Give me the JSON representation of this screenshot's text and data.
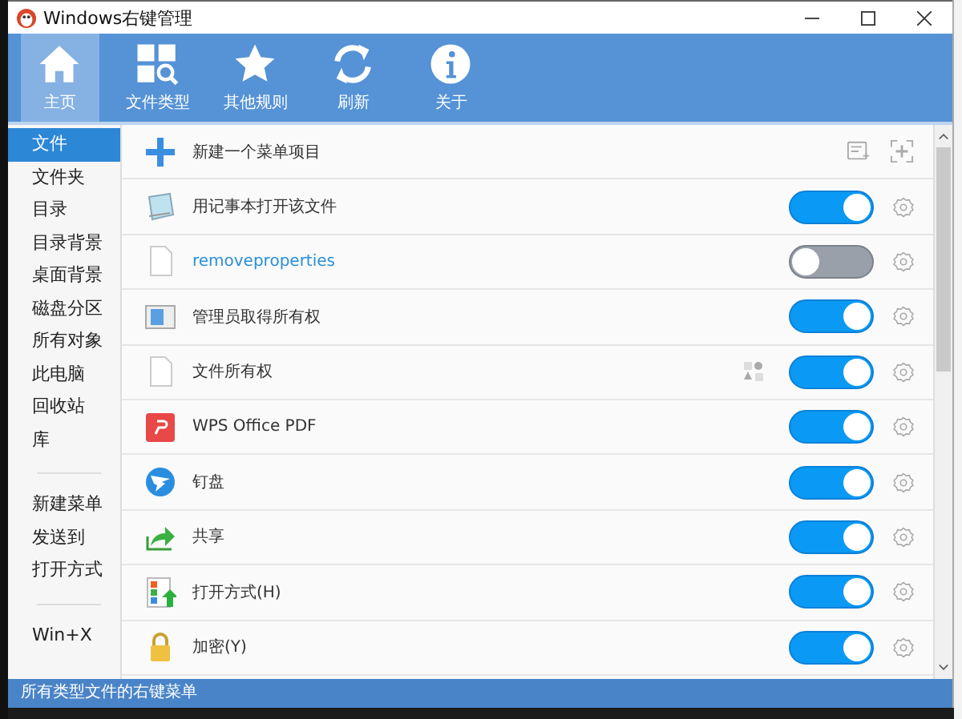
{
  "window": {
    "title": "Windows右键管理"
  },
  "toolbar": [
    {
      "label": "主页",
      "selected": true
    },
    {
      "label": "文件类型",
      "selected": false
    },
    {
      "label": "其他规则",
      "selected": false
    },
    {
      "label": "刷新",
      "selected": false
    },
    {
      "label": "关于",
      "selected": false
    }
  ],
  "sidebar": {
    "groups": [
      [
        {
          "label": "文件",
          "selected": true
        },
        {
          "label": "文件夹",
          "selected": false
        },
        {
          "label": "目录",
          "selected": false
        },
        {
          "label": "目录背景",
          "selected": false
        },
        {
          "label": "桌面背景",
          "selected": false
        },
        {
          "label": "磁盘分区",
          "selected": false
        },
        {
          "label": "所有对象",
          "selected": false
        },
        {
          "label": "此电脑",
          "selected": false
        },
        {
          "label": "回收站",
          "selected": false
        },
        {
          "label": "库",
          "selected": false
        }
      ],
      [
        {
          "label": "新建菜单",
          "selected": false
        },
        {
          "label": "发送到",
          "selected": false
        },
        {
          "label": "打开方式",
          "selected": false
        }
      ],
      [
        {
          "label": "Win+X",
          "selected": false
        }
      ]
    ]
  },
  "items": [
    {
      "kind": "new",
      "label": "新建一个菜单项目"
    },
    {
      "kind": "entry",
      "label": "用记事本打开该文件",
      "on": true,
      "highlighted": false,
      "extra": false
    },
    {
      "kind": "entry",
      "label": "removeproperties",
      "on": false,
      "highlighted": true,
      "extra": false
    },
    {
      "kind": "entry",
      "label": "管理员取得所有权",
      "on": true,
      "highlighted": false,
      "extra": false
    },
    {
      "kind": "entry",
      "label": "文件所有权",
      "on": true,
      "highlighted": false,
      "extra": true
    },
    {
      "kind": "entry",
      "label": "WPS Office PDF",
      "on": true,
      "highlighted": false,
      "extra": false
    },
    {
      "kind": "entry",
      "label": "钉盘",
      "on": true,
      "highlighted": false,
      "extra": false
    },
    {
      "kind": "entry",
      "label": "共享",
      "on": true,
      "highlighted": false,
      "extra": false
    },
    {
      "kind": "entry",
      "label": "打开方式(H)",
      "on": true,
      "highlighted": false,
      "extra": false
    },
    {
      "kind": "entry",
      "label": "加密(Y)",
      "on": true,
      "highlighted": false,
      "extra": false
    }
  ],
  "status_bar": "所有类型文件的右键菜单"
}
